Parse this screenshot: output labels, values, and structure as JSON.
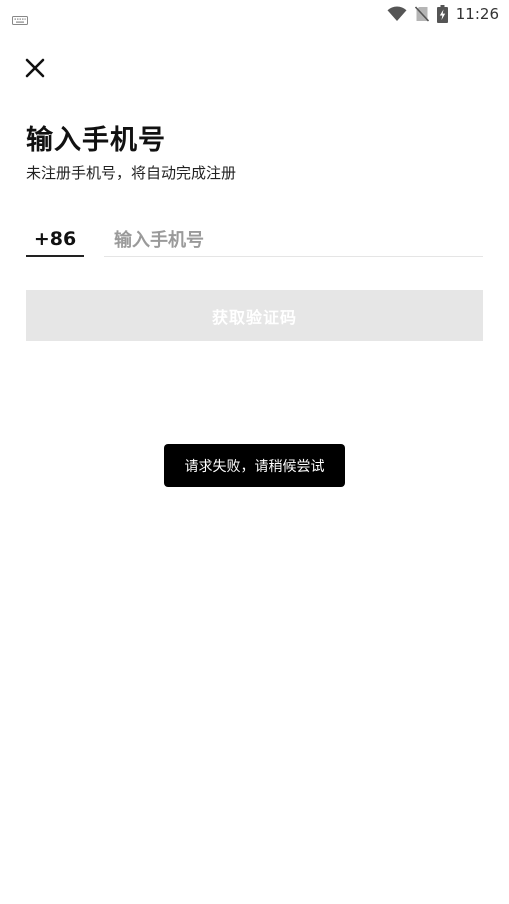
{
  "status_bar": {
    "time": "11:26",
    "icons": [
      "keyboard-icon",
      "wifi-icon",
      "no-sim-icon",
      "battery-charging-icon"
    ]
  },
  "header": {
    "close_icon": "close-icon"
  },
  "main": {
    "title": "输入手机号",
    "subtitle": "未注册手机号，将自动完成注册",
    "country_code": "+86",
    "phone_input": {
      "value": "",
      "placeholder": "输入手机号"
    },
    "get_code_label": "获取验证码"
  },
  "toast": {
    "message": "请求失败，请稍候尝试"
  },
  "colors": {
    "button_disabled_bg": "#e6e6e6",
    "toast_bg": "#000000",
    "placeholder": "#9a9a9a"
  }
}
